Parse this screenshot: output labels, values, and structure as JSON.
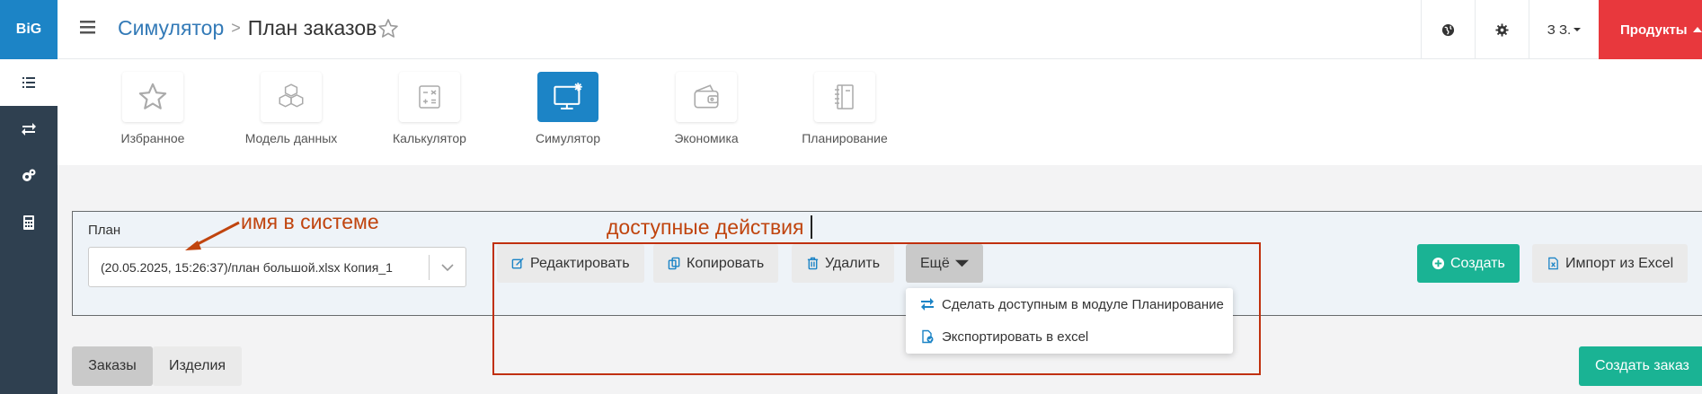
{
  "app": {
    "logo": "BiG"
  },
  "sidebar": {
    "items": [
      {
        "icon": "list-icon",
        "active": true
      },
      {
        "icon": "exchange-icon",
        "active": false
      },
      {
        "icon": "cogs-icon",
        "active": false
      },
      {
        "icon": "calculator-icon",
        "active": false
      }
    ]
  },
  "header": {
    "breadcrumb_root": "Симулятор",
    "breadcrumb_separator": ">",
    "breadcrumb_current": "План заказов",
    "user": "З З.",
    "products": "Продукты"
  },
  "modules": [
    {
      "label": "Избранное",
      "icon": "star-icon",
      "active": false
    },
    {
      "label": "Модель данных",
      "icon": "cubes-icon",
      "active": false
    },
    {
      "label": "Калькулятор",
      "icon": "calculator-icon",
      "active": false
    },
    {
      "label": "Симулятор",
      "icon": "monitor-icon",
      "active": true
    },
    {
      "label": "Экономика",
      "icon": "wallet-icon",
      "active": false
    },
    {
      "label": "Планирование",
      "icon": "notebook-icon",
      "active": false
    }
  ],
  "plan": {
    "label": "План",
    "value": "(20.05.2025, 15:26:37)/план большой.xlsx Копия_1"
  },
  "annotations": {
    "name_in_system": "имя в системе",
    "available_actions": "доступные действия"
  },
  "actions": {
    "edit": "Редактировать",
    "copy": "Копировать",
    "delete": "Удалить",
    "more": "Ещё",
    "create": "Создать",
    "import": "Импорт из Excel"
  },
  "dropdown": {
    "items": [
      "Сделать доступным в модуле Планирование",
      "Экспортировать в excel"
    ]
  },
  "tabs": [
    "Заказы",
    "Изделия"
  ],
  "create_order": "Создать заказ",
  "colors": {
    "sidebar": "#2f4050",
    "primary": "#1c84c6",
    "success": "#1ab394",
    "danger": "#e8383d",
    "annotation": "#c0440e"
  }
}
